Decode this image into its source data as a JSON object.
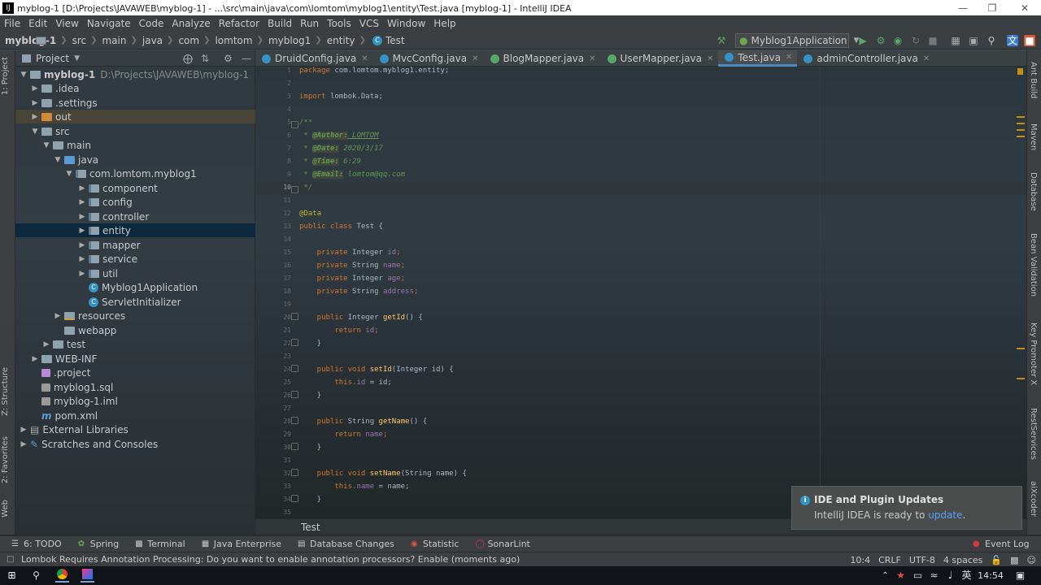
{
  "window": {
    "title": "myblog-1 [D:\\Projects\\JAVAWEB\\myblog-1] - ...\\src\\main\\java\\com\\lomtom\\myblog1\\entity\\Test.java [myblog-1] - IntelliJ IDEA",
    "app_icon_label": "IJ"
  },
  "menu": [
    "File",
    "Edit",
    "View",
    "Navigate",
    "Code",
    "Analyze",
    "Refactor",
    "Build",
    "Run",
    "Tools",
    "VCS",
    "Window",
    "Help"
  ],
  "navbar": {
    "crumbs": [
      "myblog-1",
      "src",
      "main",
      "java",
      "com",
      "lomtom",
      "myblog1",
      "entity",
      "Test"
    ],
    "run_config": "Myblog1Application"
  },
  "left_strip": {
    "project": "1: Project",
    "structure": "Z: Structure",
    "favorites": "2: Favorites",
    "web": "Web"
  },
  "right_strip": [
    "Ant Build",
    "Maven",
    "Database",
    "Bean Validation",
    "Key Promoter X",
    "RestServices",
    "aiXcoder"
  ],
  "project_panel": {
    "header": "Project",
    "tree": [
      {
        "label": "myblog-1",
        "path": "D:\\Projects\\JAVAWEB\\myblog-1"
      },
      {
        "label": ".idea"
      },
      {
        "label": ".settings"
      },
      {
        "label": "out"
      },
      {
        "label": "src"
      },
      {
        "label": "main"
      },
      {
        "label": "java"
      },
      {
        "label": "com.lomtom.myblog1"
      },
      {
        "label": "component"
      },
      {
        "label": "config"
      },
      {
        "label": "controller"
      },
      {
        "label": "entity"
      },
      {
        "label": "mapper"
      },
      {
        "label": "service"
      },
      {
        "label": "util"
      },
      {
        "label": "Myblog1Application"
      },
      {
        "label": "ServletInitializer"
      },
      {
        "label": "resources"
      },
      {
        "label": "webapp"
      },
      {
        "label": "test"
      },
      {
        "label": "WEB-INF"
      },
      {
        "label": ".project"
      },
      {
        "label": "myblog1.sql"
      },
      {
        "label": "myblog-1.iml"
      },
      {
        "label": "pom.xml"
      },
      {
        "label": "External Libraries"
      },
      {
        "label": "Scratches and Consoles"
      }
    ]
  },
  "tabs": [
    "DruidConfig.java",
    "MvcConfig.java",
    "BlogMapper.java",
    "UserMapper.java",
    "Test.java",
    "adminController.java"
  ],
  "editor": {
    "line_numbers": [
      "1",
      "2",
      "3",
      "4",
      "5",
      "6",
      "7",
      "8",
      "9",
      "10",
      "11",
      "12",
      "13",
      "14",
      "15",
      "16",
      "17",
      "18",
      "19",
      "20",
      "21",
      "22",
      "23",
      "24",
      "25",
      "26",
      "27",
      "28",
      "29",
      "30",
      "31",
      "32",
      "33",
      "34",
      "35"
    ],
    "lines": {
      "l1a": "package ",
      "l1b": "com.lomtom.myblog1.entity;",
      "l3a": "import ",
      "l3b": "lombok.Data;",
      "l5": "/**",
      "l6a": " * ",
      "l6b": "@Author:",
      "l6c": " LOMTOM",
      "l7a": " * ",
      "l7b": "@Date:",
      "l7c": " 2020/3/17",
      "l8a": " * ",
      "l8b": "@Time:",
      "l8c": " 6:29",
      "l9a": " * ",
      "l9b": "@Email:",
      "l9c": " lomtom@qq.com",
      "l10": " */",
      "l12": "@Data",
      "l13a": "public class ",
      "l13b": "Test {",
      "l15a": "    private ",
      "l15b": "Integer ",
      "l15c": "id",
      "l15d": ";",
      "l16a": "    private ",
      "l16b": "String ",
      "l16c": "name",
      "l16d": ";",
      "l17a": "    private ",
      "l17b": "Integer ",
      "l17c": "age",
      "l17d": ";",
      "l18a": "    private ",
      "l18b": "String ",
      "l18c": "address",
      "l18d": ";",
      "l20a": "    public ",
      "l20b": "Integer ",
      "l20c": "getId",
      "l20d": "() {",
      "l21a": "        return ",
      "l21b": "id",
      "l21c": ";",
      "l22": "    }",
      "l24a": "    public void ",
      "l24b": "setId",
      "l24c": "(Integer id) {",
      "l25a": "        this.",
      "l25b": "id",
      "l25c": " = id;",
      "l26": "    }",
      "l28a": "    public ",
      "l28b": "String ",
      "l28c": "getName",
      "l28d": "() {",
      "l29a": "        return ",
      "l29b": "name",
      "l29c": ";",
      "l30": "    }",
      "l32a": "    public void ",
      "l32b": "setName",
      "l32c": "(String name) {",
      "l33a": "        this.",
      "l33b": "name",
      "l33c": " = name;",
      "l34": "    }"
    },
    "breadcrumb": "Test"
  },
  "notification": {
    "title": "IDE and Plugin Updates",
    "body": "IntelliJ IDEA is ready to ",
    "link": "update",
    "period": "."
  },
  "tool_windows": [
    "6: TODO",
    "Spring",
    "Terminal",
    "Java Enterprise",
    "Database Changes",
    "Statistic",
    "SonarLint"
  ],
  "event_log": "Event Log",
  "status": {
    "message": "Lombok Requires Annotation Processing: Do you want to enable annotation processors? Enable (moments ago)",
    "position": "10:4",
    "line_sep": "CRLF",
    "encoding": "UTF-8",
    "indent": "4 spaces"
  },
  "taskbar": {
    "ime": "英",
    "time": "14:54"
  }
}
